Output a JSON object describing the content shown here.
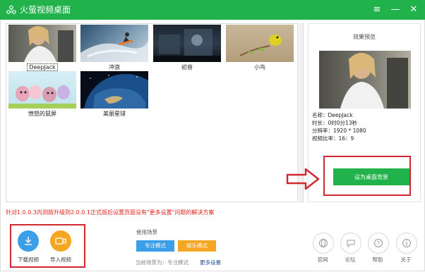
{
  "app": {
    "title": "火萤视频桌面"
  },
  "window_controls": {
    "menu": "≡",
    "minimize": "—",
    "close": "✕"
  },
  "gallery": {
    "items": [
      {
        "caption": "DeepJack",
        "selected": true
      },
      {
        "caption": "冲浪",
        "selected": false
      },
      {
        "caption": "初音",
        "selected": false
      },
      {
        "caption": "小鸟",
        "selected": false
      },
      {
        "caption": "愤怒的鼠屏",
        "selected": false
      },
      {
        "caption": "美丽星球",
        "selected": false
      }
    ]
  },
  "preview": {
    "heading": "效果预览",
    "name": "名称：DeepJack",
    "duration": "时长：0时0分13秒",
    "resolution": "分辨率：1920 * 1080",
    "aspect": "视频比率：16：9"
  },
  "set_background_label": "设为桌面背景",
  "notice": "针对1.0.0.3内测版升级到2.0.0.1正式版后设置页面没有\"更多设置\"问题的解决方案",
  "bottom_left": {
    "download_label": "下载视频",
    "import_label": "导入视频"
  },
  "scene": {
    "title": "使用场景",
    "focus_mode": "专注模式",
    "entertain_mode": "娱乐模式",
    "current": "当前场景为：专注模式",
    "more_settings": "更多设置"
  },
  "right_icons": {
    "official_site": "官网",
    "forum": "论坛",
    "help": "帮助",
    "about": "关于"
  },
  "colors": {
    "brand_green": "#22b24c",
    "alert_red": "#d0282e",
    "download_blue": "#3a9ee8",
    "import_orange": "#f5a623",
    "focus_blue": "#3a9ee8",
    "entertain_orange": "#f5a623"
  }
}
